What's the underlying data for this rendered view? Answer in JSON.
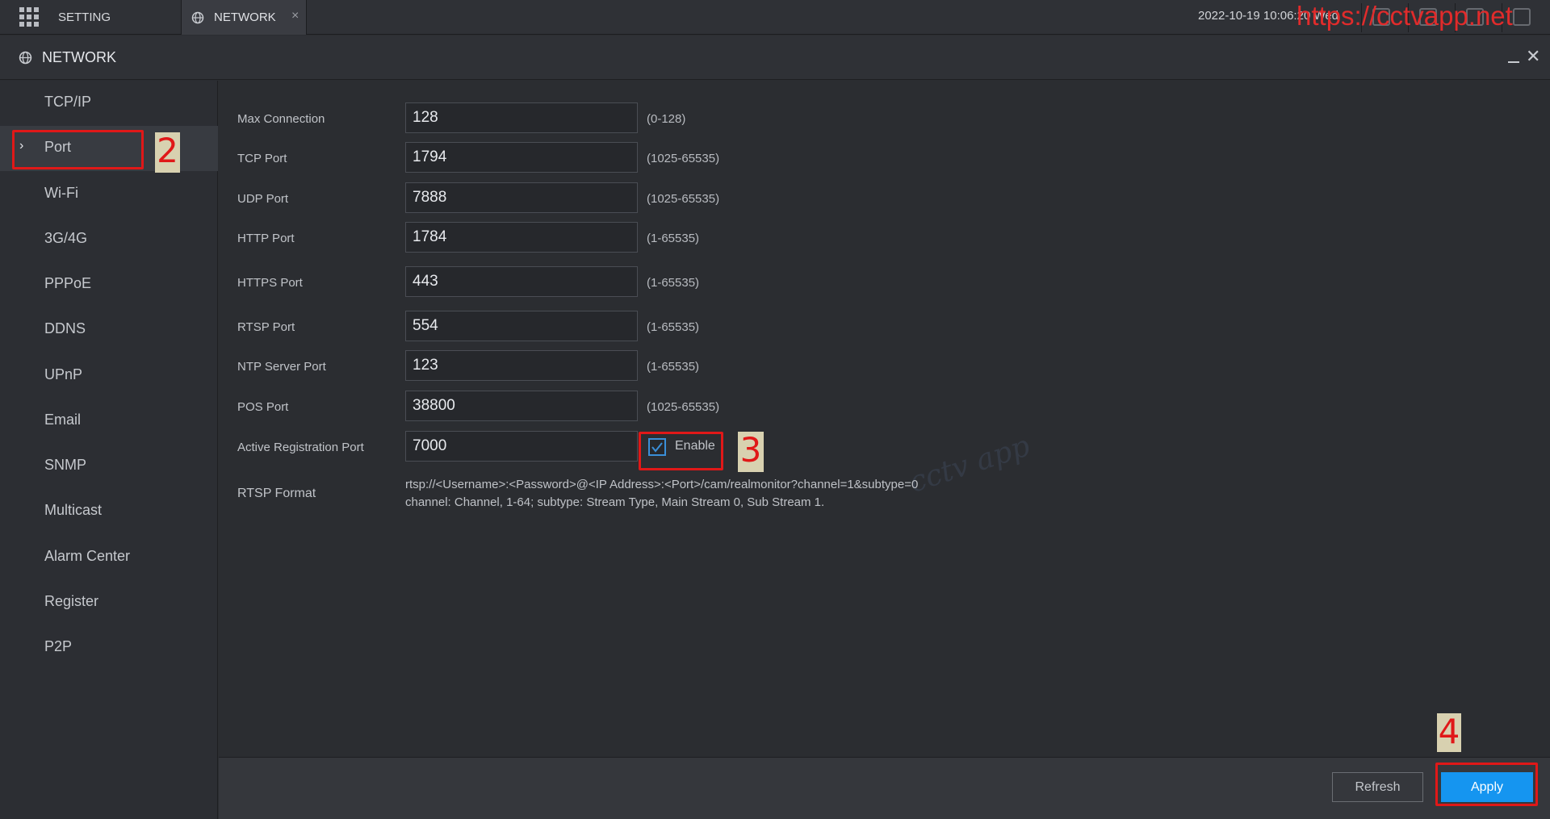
{
  "topbar": {
    "setting_label": "SETTING",
    "tab_label": "NETWORK",
    "tab_close": "×",
    "datetime": "2022-10-19 10:06:20 Wed",
    "watermark": "https://cctvapp.net"
  },
  "window": {
    "title": "NETWORK",
    "close": "✕"
  },
  "sidebar": {
    "items": [
      {
        "label": "TCP/IP"
      },
      {
        "label": "Port",
        "active": true
      },
      {
        "label": "Wi-Fi"
      },
      {
        "label": "3G/4G"
      },
      {
        "label": "PPPoE"
      },
      {
        "label": "DDNS"
      },
      {
        "label": "UPnP"
      },
      {
        "label": "Email"
      },
      {
        "label": "SNMP"
      },
      {
        "label": "Multicast"
      },
      {
        "label": "Alarm Center"
      },
      {
        "label": "Register"
      },
      {
        "label": "P2P"
      }
    ],
    "active_arrow": "›"
  },
  "form": {
    "fields": [
      {
        "label": "Max Connection",
        "value": "128",
        "range": "(0-128)"
      },
      {
        "label": "TCP Port",
        "value": "1794",
        "range": "(1025-65535)"
      },
      {
        "label": "UDP Port",
        "value": "7888",
        "range": "(1025-65535)"
      },
      {
        "label": "HTTP Port",
        "value": "1784",
        "range": "(1-65535)"
      },
      {
        "label": "HTTPS Port",
        "value": "443",
        "range": "(1-65535)"
      },
      {
        "label": "RTSP Port",
        "value": "554",
        "range": "(1-65535)"
      },
      {
        "label": "NTP Server Port",
        "value": "123",
        "range": "(1-65535)"
      },
      {
        "label": "POS Port",
        "value": "38800",
        "range": "(1025-65535)"
      },
      {
        "label": "Active Registration Port",
        "value": "7000",
        "enable_label": "Enable",
        "enabled": true
      }
    ],
    "rtsp_format_label": "RTSP Format",
    "rtsp_format_line1": "rtsp://<Username>:<Password>@<IP Address>:<Port>/cam/realmonitor?channel=1&subtype=0",
    "rtsp_format_line2": "channel: Channel, 1-64; subtype: Stream Type, Main Stream 0, Sub Stream 1."
  },
  "buttons": {
    "refresh": "Refresh",
    "apply": "Apply"
  },
  "annotations": {
    "step2": "2",
    "step3": "3",
    "step4": "4",
    "highlight_color": "#e01818"
  },
  "colors": {
    "accent": "#1595f0",
    "checkbox": "#3a8fd8"
  }
}
